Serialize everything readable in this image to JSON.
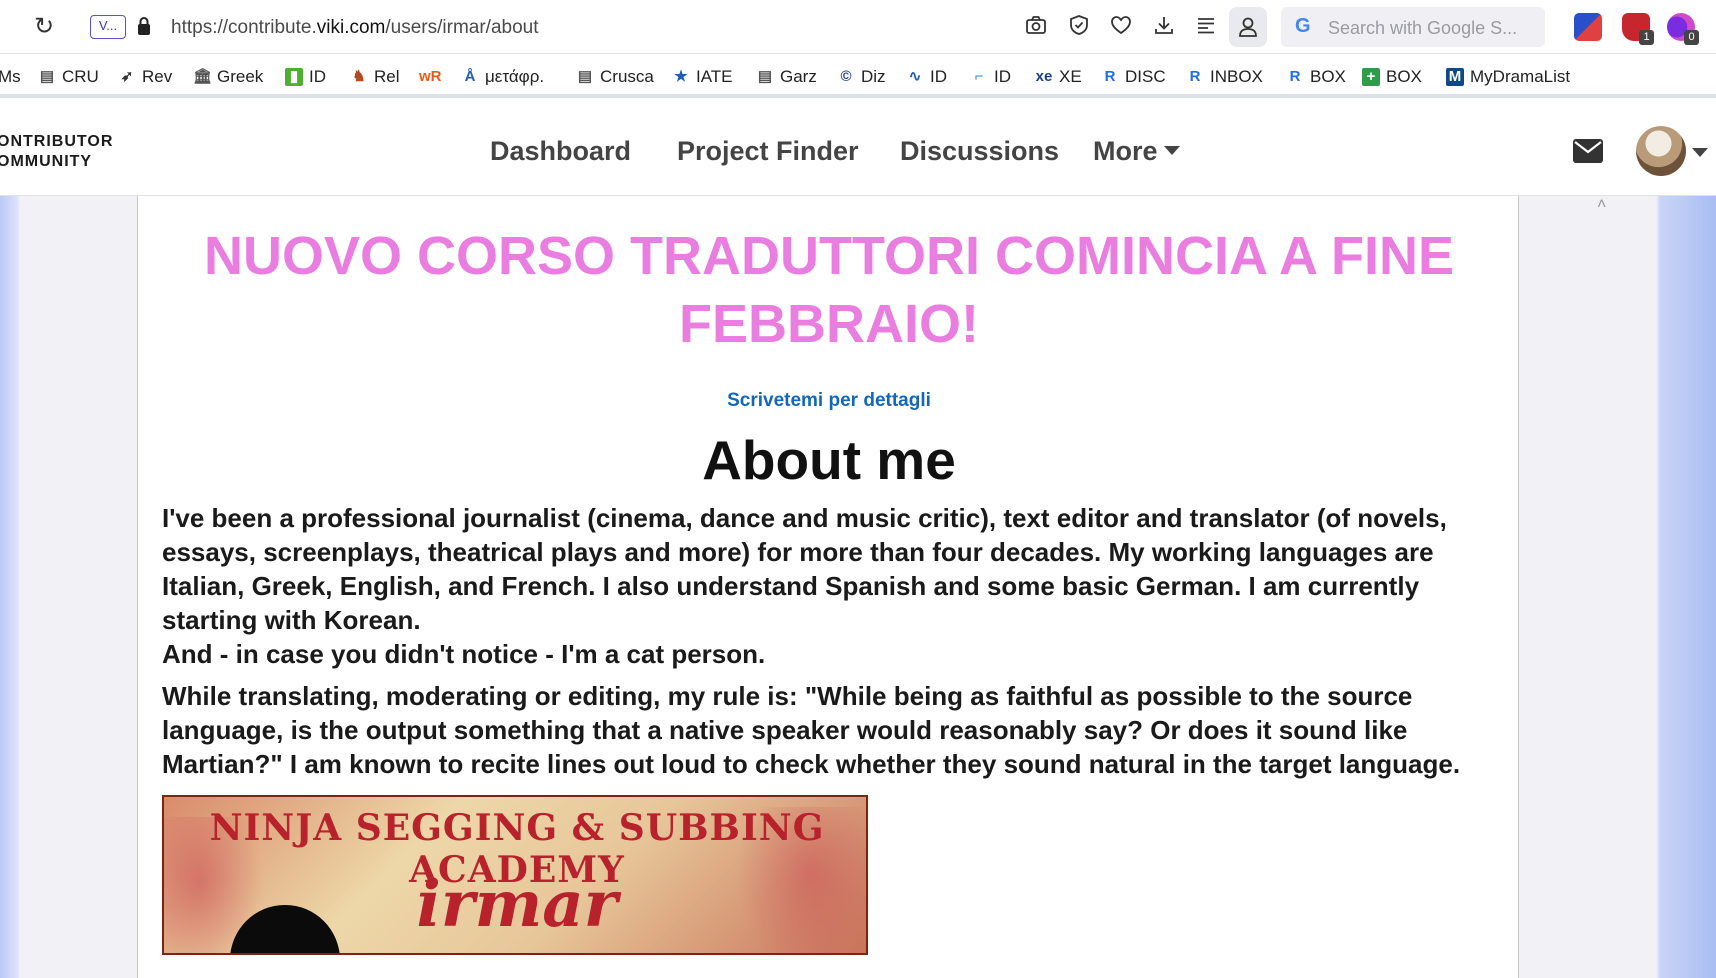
{
  "browser": {
    "site_badge": "V...",
    "url_prefix": "https://contribute.",
    "url_domain": "viki.com",
    "url_path": "/users/irmar/about",
    "search_placeholder": "Search with Google S...",
    "extensions": [
      {
        "name": "ext-1",
        "count": ""
      },
      {
        "name": "ext-2",
        "count": "1"
      },
      {
        "name": "ext-3",
        "count": "0"
      }
    ]
  },
  "bookmarks": [
    {
      "label": "Ms",
      "icon": "",
      "color": "#444"
    },
    {
      "label": "CRU",
      "icon": "page",
      "color": "#555"
    },
    {
      "label": "Rev",
      "icon": "bird",
      "color": "#333"
    },
    {
      "label": "Greek",
      "icon": "temple",
      "color": "#555"
    },
    {
      "label": "ID",
      "icon": "green-doc",
      "color": "#4caf30"
    },
    {
      "label": "Rel",
      "icon": "elephant",
      "color": "#b24b1f"
    },
    {
      "label": "",
      "icon": "wr",
      "color": "#e85c1a"
    },
    {
      "label": "μετάφρ.",
      "icon": "globe-a",
      "color": "#1f5fb0"
    },
    {
      "label": "Crusca",
      "icon": "page",
      "color": "#555"
    },
    {
      "label": "IATE",
      "icon": "star",
      "color": "#1f5fb0"
    },
    {
      "label": "Garz",
      "icon": "page",
      "color": "#555"
    },
    {
      "label": "Diz",
      "icon": "c-circle",
      "color": "#1f3f8f"
    },
    {
      "label": "ID",
      "icon": "wave",
      "color": "#1f5fb0"
    },
    {
      "label": "ID",
      "icon": "bracket",
      "color": "#1e88e5"
    },
    {
      "label": "XE",
      "icon": "xe",
      "color": "#1f3f8f"
    },
    {
      "label": "DISC",
      "icon": "r",
      "color": "#1e6ee5"
    },
    {
      "label": "INBOX",
      "icon": "r",
      "color": "#1e6ee5"
    },
    {
      "label": "BOX",
      "icon": "r",
      "color": "#1e6ee5"
    },
    {
      "label": "BOX",
      "icon": "plus",
      "color": "#2e9d4a"
    },
    {
      "label": "MyDramaList",
      "icon": "mdl",
      "color": "#0f4a85"
    }
  ],
  "site": {
    "brand_line1": "ONTRIBUTOR",
    "brand_line2": "OMMUNITY",
    "nav": [
      "Dashboard",
      "Project Finder",
      "Discussions",
      "More"
    ]
  },
  "page": {
    "banner": "NUOVO CORSO TRADUTTORI COMINCIA A FINE FEBBRAIO!",
    "contact_link": "Scrivetemi per dettagli",
    "about_title": "About me",
    "paragraph_1": "I've been a professional journalist (cinema, dance and music critic), text editor and translator (of novels, essays, screenplays, theatrical plays and more) for more than four decades. My working languages are Italian, Greek, English, and French. I also understand Spanish and some basic German. I am currently starting with Korean.",
    "paragraph_2": "And - in case you didn't notice - I'm a cat person.",
    "paragraph_3": "While translating, moderating or editing, my rule is: \"While being as faithful as possible to the source language, is the output something that a native speaker would reasonably say? Or does it sound like Martian?\" I am known to recite lines out loud to check whether they sound natural in the target language.",
    "academy_heading": "NINJA SEGGING & SUBBING ACADEMY",
    "academy_name": "irmar"
  },
  "colors": {
    "banner": "#ea7ee0",
    "link": "#1467b8",
    "academy_red": "#b8222b"
  }
}
